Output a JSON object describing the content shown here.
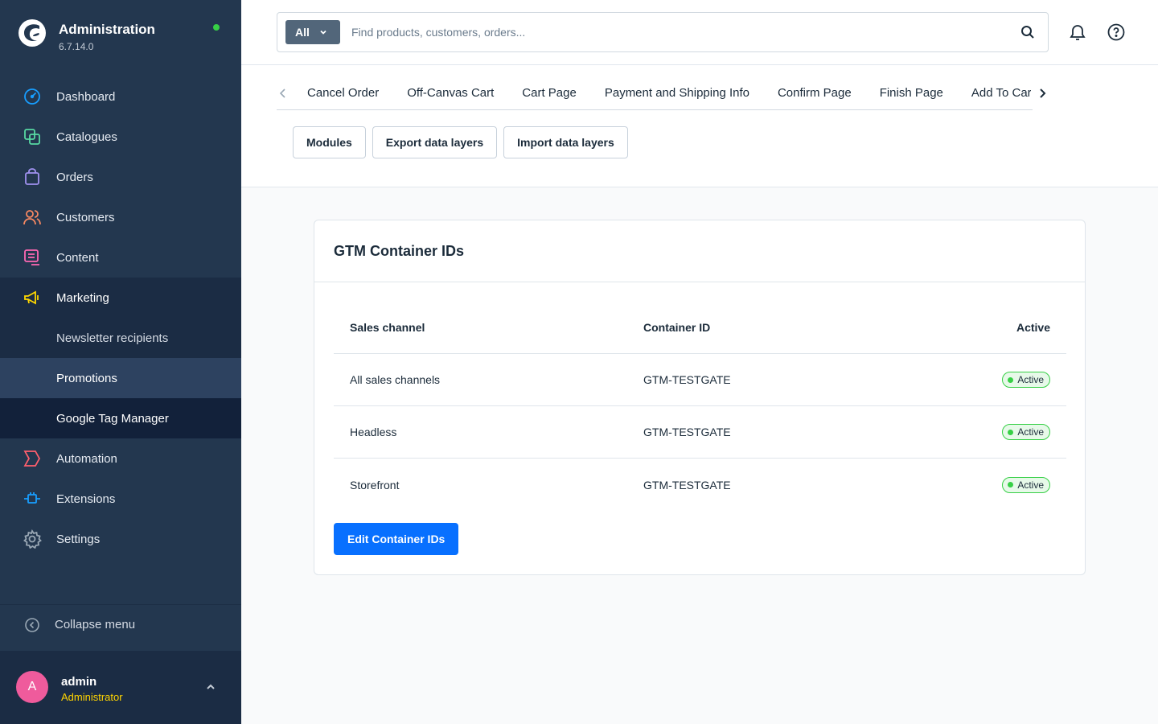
{
  "brand": {
    "title": "Administration",
    "version": "6.7.14.0"
  },
  "sidebar": {
    "items": [
      {
        "label": "Dashboard",
        "icon": "dashboard-icon",
        "color": "#189eff"
      },
      {
        "label": "Catalogues",
        "icon": "catalogue-icon",
        "color": "#57d9a3"
      },
      {
        "label": "Orders",
        "icon": "shopping-bag-icon",
        "color": "#a092f0"
      },
      {
        "label": "Customers",
        "icon": "users-icon",
        "color": "#f88962"
      },
      {
        "label": "Content",
        "icon": "content-icon",
        "color": "#ff68b4"
      },
      {
        "label": "Marketing",
        "icon": "megaphone-icon",
        "color": "#ffd700"
      },
      {
        "label": "Newsletter recipients"
      },
      {
        "label": "Promotions"
      },
      {
        "label": "Google Tag Manager"
      },
      {
        "label": "Automation",
        "icon": "automation-icon",
        "color": "#ff5f6d"
      },
      {
        "label": "Extensions",
        "icon": "plug-icon",
        "color": "#189eff"
      },
      {
        "label": "Settings",
        "icon": "gear-icon",
        "color": "#9aa8b5"
      }
    ],
    "collapse_label": "Collapse menu"
  },
  "user": {
    "initial": "A",
    "name": "admin",
    "role": "Administrator"
  },
  "search": {
    "type_label": "All",
    "placeholder": "Find products, customers, orders..."
  },
  "tabs": [
    "Cancel Order",
    "Off-Canvas Cart",
    "Cart Page",
    "Payment and Shipping Info",
    "Confirm Page",
    "Finish Page",
    "Add To Cart"
  ],
  "actions": {
    "modules": "Modules",
    "export": "Export data layers",
    "import": "Import data layers"
  },
  "card": {
    "title": "GTM Container IDs",
    "columns": [
      "Sales channel",
      "Container ID",
      "Active"
    ],
    "rows": [
      {
        "channel": "All sales channels",
        "container": "GTM-TESTGATE",
        "status": "Active"
      },
      {
        "channel": "Headless",
        "container": "GTM-TESTGATE",
        "status": "Active"
      },
      {
        "channel": "Storefront",
        "container": "GTM-TESTGATE",
        "status": "Active"
      }
    ],
    "edit_button": "Edit Container IDs"
  },
  "colors": {
    "sidebar_bg": "#23374f",
    "primary": "#0870ff",
    "status_active": "#37d046",
    "avatar": "#ef5b9c",
    "role": "#ffd400"
  }
}
